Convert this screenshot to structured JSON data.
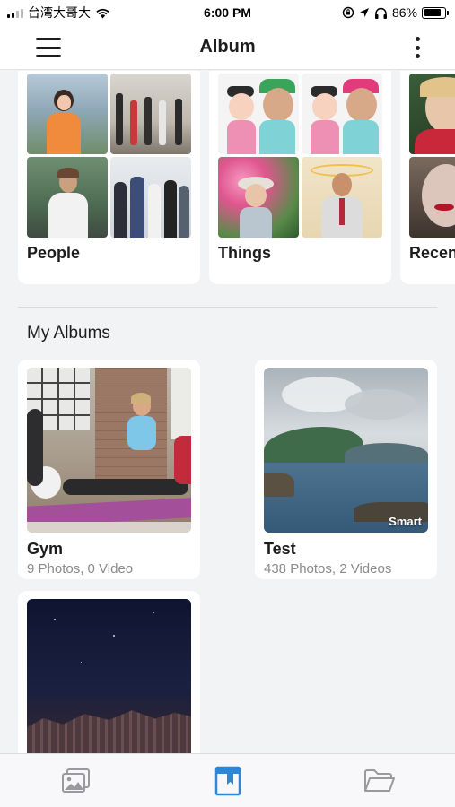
{
  "status_bar": {
    "carrier": "台湾大哥大",
    "time": "6:00 PM",
    "battery": "86%",
    "battery_level": 0.86
  },
  "nav": {
    "title": "Album"
  },
  "categories": [
    {
      "label": "People"
    },
    {
      "label": "Things"
    },
    {
      "label": "Recent"
    }
  ],
  "my_albums": {
    "title": "My Albums",
    "albums": [
      {
        "name": "Gym",
        "meta": "9 Photos, 0 Video"
      },
      {
        "name": "Test",
        "meta": "438 Photos, 2 Videos",
        "badge": "Smart"
      },
      {
        "name": "",
        "meta": ""
      }
    ]
  },
  "tab_bar": {
    "active": "albums"
  },
  "colors": {
    "accent": "#2f86d4",
    "inactive_icon": "#9a9a9e"
  }
}
